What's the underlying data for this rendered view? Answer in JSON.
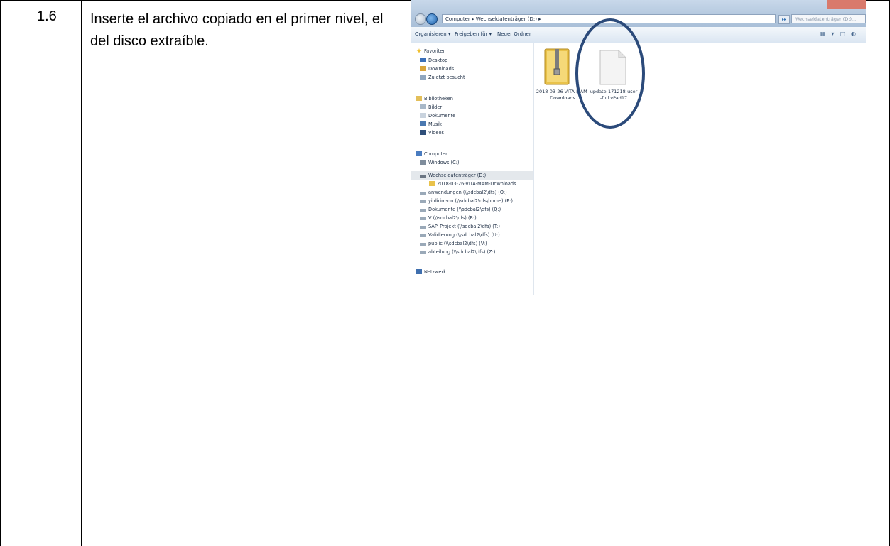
{
  "row": {
    "step_number": "1.6",
    "instruction": "Inserte el archivo copiado en el primer nivel, el del disco extraíble."
  },
  "explorer": {
    "breadcrumb": "Computer ▸ Wechseldatenträger (D:) ▸",
    "search_placeholder": "Wechseldatenträger (D:)...",
    "toolbar": {
      "organize": "Organisieren ▾",
      "share": "Freigeben für ▾",
      "new_folder": "Neuer Ordner"
    },
    "nav": {
      "favorites": "Favoriten",
      "desktop": "Desktop",
      "downloads": "Downloads",
      "recent": "Zuletzt besucht",
      "libraries": "Bibliotheken",
      "pictures": "Bilder",
      "documents": "Dokumente",
      "music": "Musik",
      "videos": "Videos",
      "computer": "Computer",
      "drive_c": "Windows (C:)",
      "drive_d": "Wechseldatenträger (D:)",
      "folder_vita": "2018-03-26-VITA-MAM-Downloads",
      "drive_o": "anwendungen (\\\\sdcbal2\\dfs) (O:)",
      "drive_p": "yildirim-on (\\\\sdcbal2\\dfs\\home) (P:)",
      "drive_q": "Dokumente (\\\\sdcbal2\\dfs) (Q:)",
      "drive_r": "V (\\\\sdcbal2\\dfs) (R:)",
      "drive_t": "SAP_Projekt (\\\\sdcbal2\\dfs) (T:)",
      "drive_u": "Validierung (\\\\sdcbal2\\dfs) (U:)",
      "drive_v": "public (\\\\sdcbal2\\dfs) (V:)",
      "drive_z": "abteilung (\\\\sdcbal2\\dfs) (Z:)",
      "network": "Netzwerk"
    },
    "files": {
      "zip_name": "2018-03-26-VITA-MAM-Downloads",
      "update_name": "update-171218-user-full.vPad17"
    },
    "colors": {
      "highlight_circle": "#2b4a7a",
      "folder": "#e9c24a"
    }
  }
}
